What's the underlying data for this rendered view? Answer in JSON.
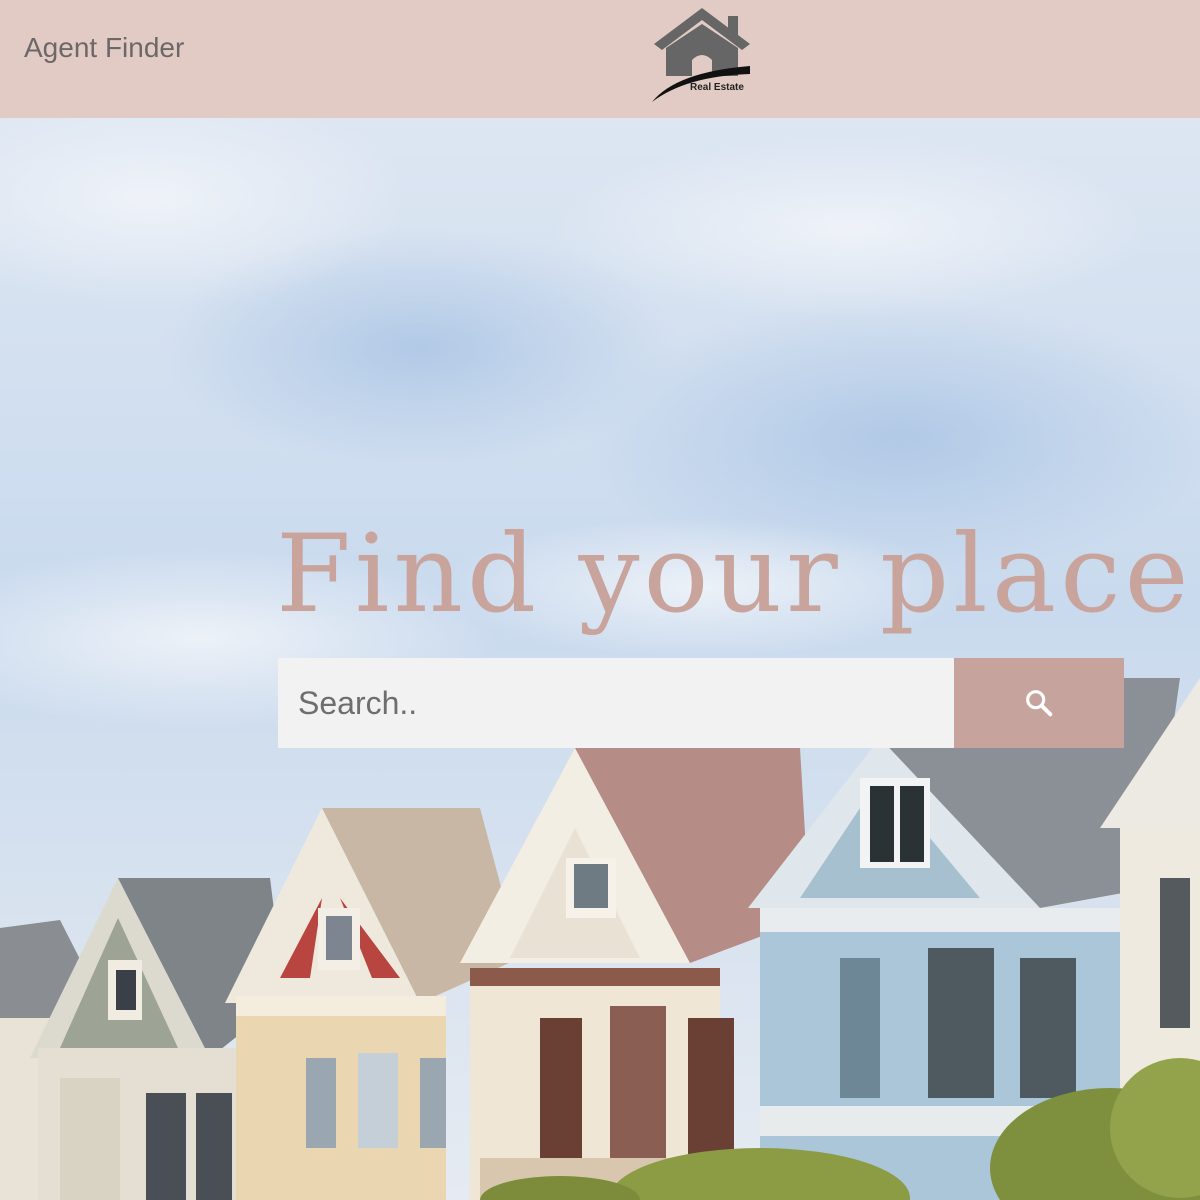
{
  "header": {
    "nav_link": "Agent Finder",
    "logo_text": "Real Estate"
  },
  "hero": {
    "headline": "Find your place",
    "search_placeholder": "Search..",
    "search_icon": "search-icon"
  },
  "colors": {
    "header_bg": "#e2cbc4",
    "headline": "#c8a49c",
    "search_button": "#c6a39d",
    "search_input_bg": "#f2f2f2"
  }
}
